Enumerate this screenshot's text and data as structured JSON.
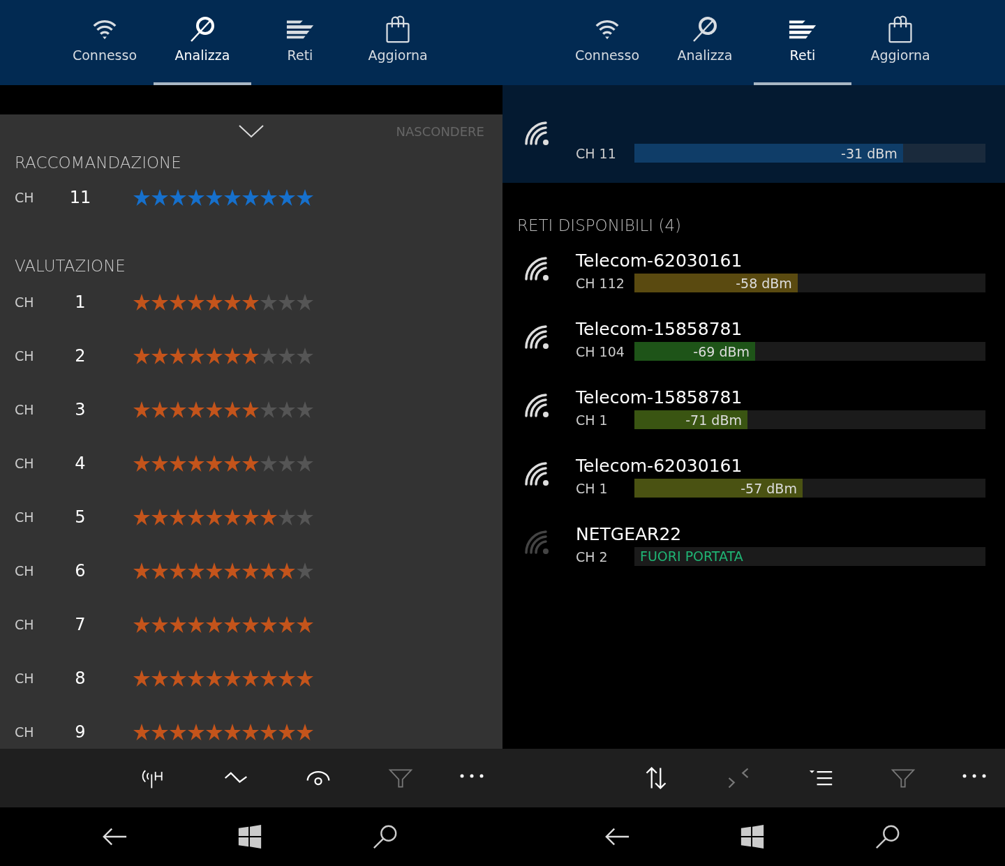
{
  "screens": [
    {
      "kind": "analyze",
      "tabs": [
        {
          "label": "Connesso",
          "selected": false
        },
        {
          "label": "Analizza",
          "selected": true
        },
        {
          "label": "Reti",
          "selected": false
        },
        {
          "label": "Aggiorna",
          "selected": false
        }
      ],
      "hide_label": "NASCONDERE",
      "recommendation": {
        "title": "RACCOMANDAZIONE",
        "rows": [
          {
            "label": "CH",
            "channel": "11",
            "stars": 10
          }
        ]
      },
      "rating": {
        "title": "VALUTAZIONE",
        "rows": [
          {
            "label": "CH",
            "channel": "1",
            "stars": 7
          },
          {
            "label": "CH",
            "channel": "2",
            "stars": 7
          },
          {
            "label": "CH",
            "channel": "3",
            "stars": 7
          },
          {
            "label": "CH",
            "channel": "4",
            "stars": 7
          },
          {
            "label": "CH",
            "channel": "5",
            "stars": 8
          },
          {
            "label": "CH",
            "channel": "6",
            "stars": 9
          },
          {
            "label": "CH",
            "channel": "7",
            "stars": 10
          },
          {
            "label": "CH",
            "channel": "8",
            "stars": 10
          },
          {
            "label": "CH",
            "channel": "9",
            "stars": 10
          }
        ]
      },
      "app_bar": [
        {
          "kind": "antenna",
          "disabled": false
        },
        {
          "kind": "zigzag",
          "disabled": false
        },
        {
          "kind": "eye",
          "disabled": false
        },
        {
          "kind": "filter",
          "disabled": true
        },
        {
          "kind": "more",
          "disabled": false
        }
      ]
    },
    {
      "kind": "networks",
      "tabs": [
        {
          "label": "Connesso",
          "selected": false
        },
        {
          "label": "Analizza",
          "selected": false
        },
        {
          "label": "Reti",
          "selected": true
        },
        {
          "label": "Aggiorna",
          "selected": false
        }
      ],
      "connected": {
        "channel": "CH 11",
        "reading": "-31 dBm",
        "level": 0.765,
        "color": "#0f3d68"
      },
      "available": {
        "title": "RETI DISPONIBILI (4)",
        "networks": [
          {
            "kind": "signal",
            "name": "Telecom-62030161",
            "channel": "CH 112",
            "reading": "-58 dBm",
            "level": 0.465,
            "color": "#5a4a10"
          },
          {
            "kind": "signal",
            "name": "Telecom-15858781",
            "channel": "CH 104",
            "reading": "-69 dBm",
            "level": 0.344,
            "color": "#1e5418"
          },
          {
            "kind": "signal",
            "name": "Telecom-15858781",
            "channel": "CH 1",
            "reading": "-71 dBm",
            "level": 0.322,
            "color": "#3a5512"
          },
          {
            "kind": "signal",
            "name": "Telecom-62030161",
            "channel": "CH 1",
            "reading": "-57 dBm",
            "level": 0.479,
            "color": "#4a5212"
          },
          {
            "kind": "out_of_range",
            "name": "NETGEAR22",
            "channel": "CH 2",
            "reading": "FUORI PORTATA"
          }
        ]
      },
      "app_bar": [
        {
          "kind": "sort",
          "disabled": false
        },
        {
          "kind": "collapse",
          "disabled": true
        },
        {
          "kind": "list",
          "disabled": false
        },
        {
          "kind": "filter",
          "disabled": true
        },
        {
          "kind": "more",
          "disabled": false
        }
      ]
    }
  ]
}
